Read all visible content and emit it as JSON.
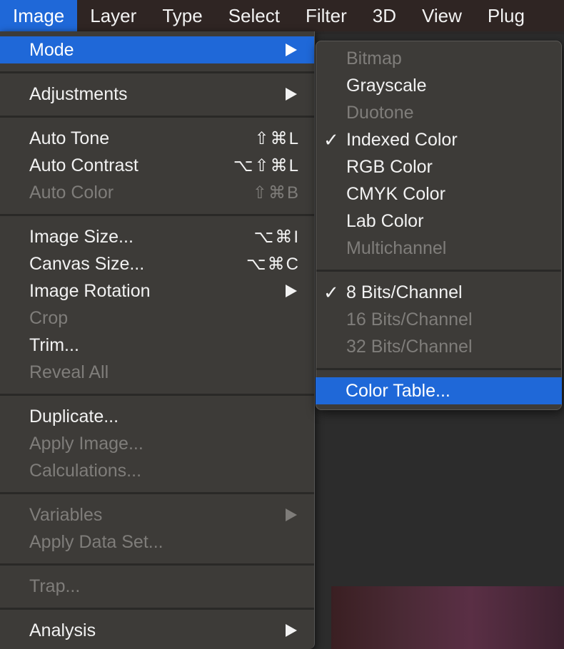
{
  "menubar": {
    "items": [
      "Image",
      "Layer",
      "Type",
      "Select",
      "Filter",
      "3D",
      "View",
      "Plug"
    ]
  },
  "image_menu": {
    "items": [
      {
        "label": "Mode",
        "submenu": true,
        "highlighted": true
      },
      {
        "label": "Adjustments",
        "submenu": true
      },
      {
        "label": "Auto Tone",
        "shortcut": "⇧⌘L"
      },
      {
        "label": "Auto Contrast",
        "shortcut": "⌥⇧⌘L"
      },
      {
        "label": "Auto Color",
        "shortcut": "⇧⌘B",
        "disabled": true
      },
      {
        "label": "Image Size...",
        "shortcut": "⌥⌘I"
      },
      {
        "label": "Canvas Size...",
        "shortcut": "⌥⌘C"
      },
      {
        "label": "Image Rotation",
        "submenu": true
      },
      {
        "label": "Crop",
        "disabled": true
      },
      {
        "label": "Trim..."
      },
      {
        "label": "Reveal All",
        "disabled": true
      },
      {
        "label": "Duplicate..."
      },
      {
        "label": "Apply Image...",
        "disabled": true
      },
      {
        "label": "Calculations...",
        "disabled": true
      },
      {
        "label": "Variables",
        "submenu": true,
        "disabled": true
      },
      {
        "label": "Apply Data Set...",
        "disabled": true
      },
      {
        "label": "Trap...",
        "disabled": true
      },
      {
        "label": "Analysis",
        "submenu": true
      }
    ]
  },
  "mode_submenu": {
    "items": [
      {
        "label": "Bitmap",
        "disabled": true
      },
      {
        "label": "Grayscale"
      },
      {
        "label": "Duotone",
        "disabled": true
      },
      {
        "label": "Indexed Color",
        "checked": true
      },
      {
        "label": "RGB Color"
      },
      {
        "label": "CMYK Color"
      },
      {
        "label": "Lab Color"
      },
      {
        "label": "Multichannel",
        "disabled": true
      },
      {
        "label": "8 Bits/Channel",
        "checked": true
      },
      {
        "label": "16 Bits/Channel",
        "disabled": true
      },
      {
        "label": "32 Bits/Channel",
        "disabled": true
      },
      {
        "label": "Color Table...",
        "highlighted": true
      }
    ],
    "check_glyph": "✓"
  },
  "colors": {
    "accent": "#1f68d8",
    "menu_bg": "#3d3b38",
    "text": "#f2f2f2",
    "disabled_text": "#7f7d7a"
  }
}
